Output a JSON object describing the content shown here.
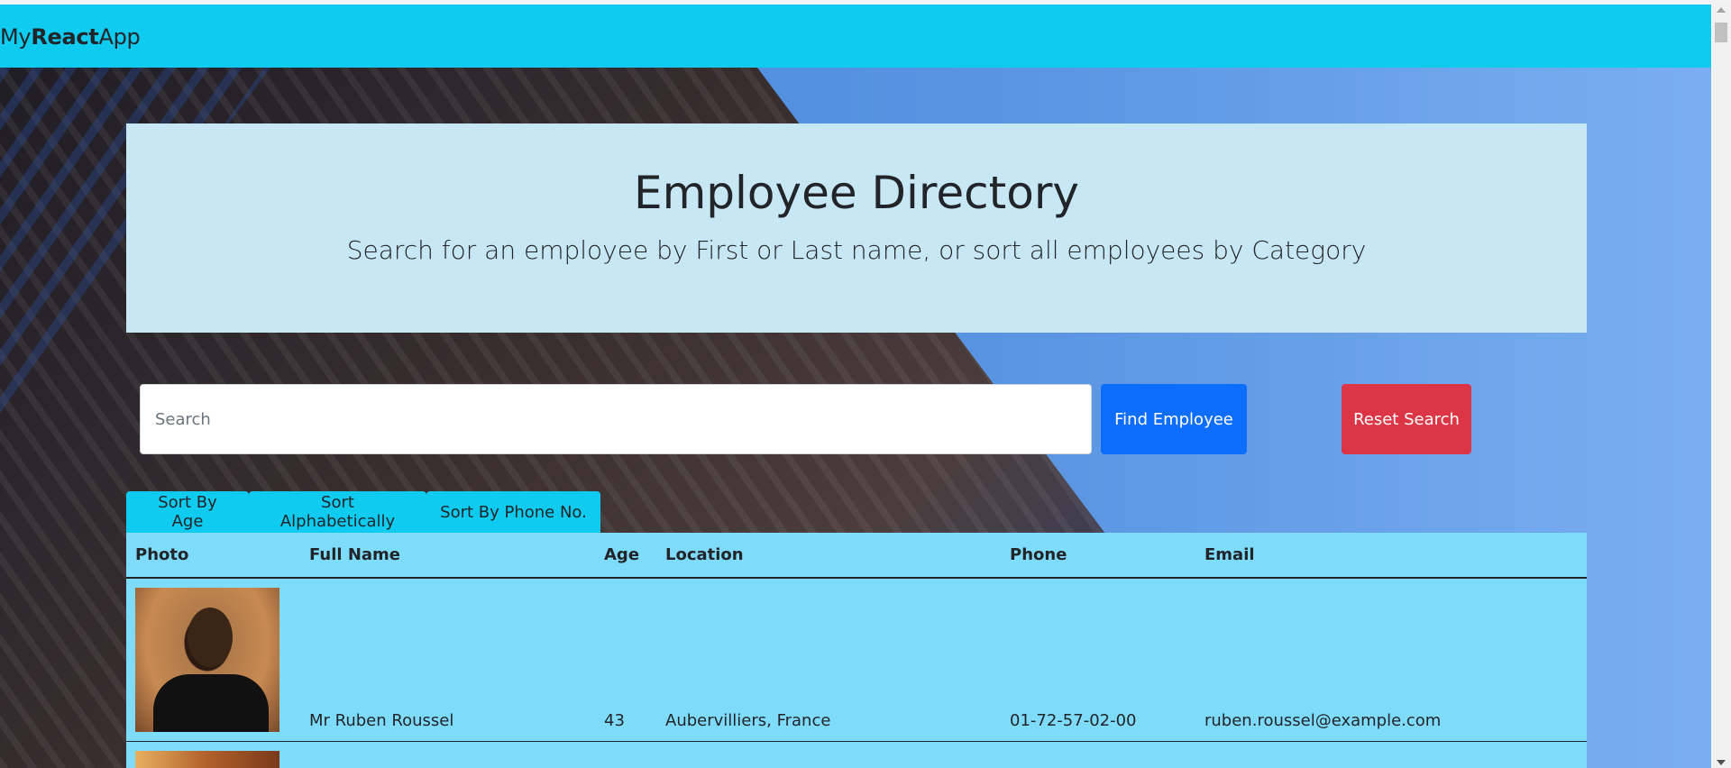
{
  "navbar": {
    "brand_prefix": "My",
    "brand_bold": "React",
    "brand_suffix": "App"
  },
  "jumbotron": {
    "title": "Employee Directory",
    "subtitle": "Search for an employee by First or Last name, or sort all employees by Category"
  },
  "search": {
    "placeholder": "Search",
    "value": "",
    "find_label": "Find Employee",
    "reset_label": "Reset Search"
  },
  "sort_buttons": {
    "age": "Sort By Age",
    "alpha": "Sort Alphabetically",
    "phone": "Sort By Phone No."
  },
  "table": {
    "headers": [
      "Photo",
      "Full Name",
      "Age",
      "Location",
      "Phone",
      "Email"
    ],
    "rows": [
      {
        "full_name": "Mr Ruben Roussel",
        "age": "43",
        "location": "Aubervilliers, France",
        "phone": "01-72-57-02-00",
        "email": "ruben.roussel@example.com"
      }
    ]
  },
  "colors": {
    "navbar": "#0fcbf0",
    "jumbotron": "#c8e7f4",
    "find_button": "#0d6efd",
    "reset_button": "#dc3545",
    "table_bg": "#7fdbfa"
  }
}
